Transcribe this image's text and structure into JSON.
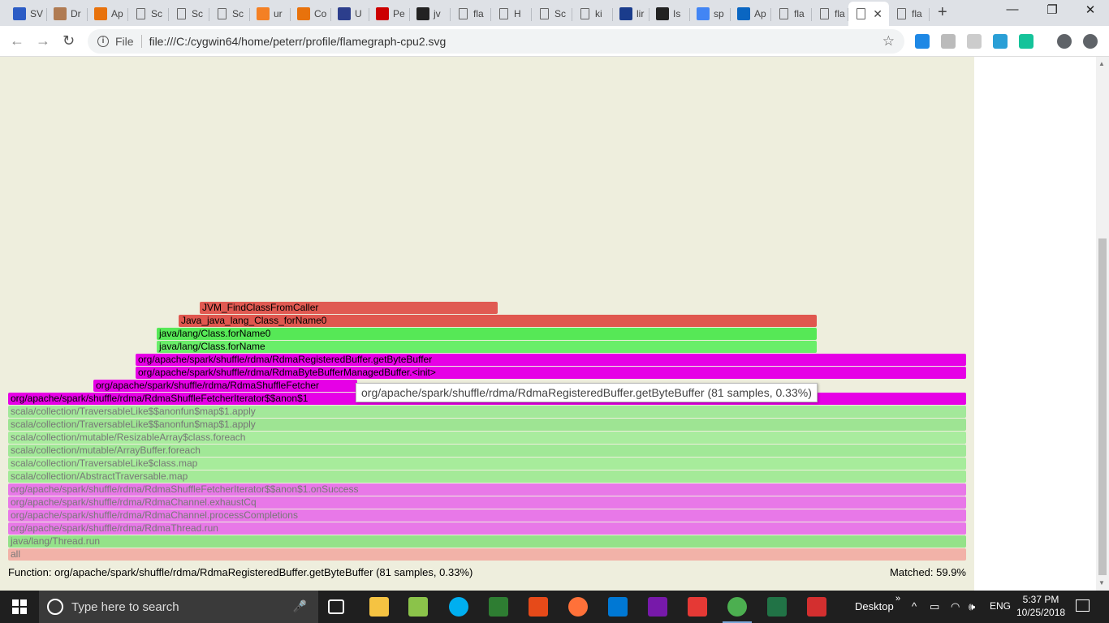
{
  "browser": {
    "tabs": [
      {
        "label": "SV",
        "icon": "atlassian-icon",
        "color": "#2c5cc5"
      },
      {
        "label": "Dr",
        "icon": "avatar-icon",
        "color": "#b07b52"
      },
      {
        "label": "Ap",
        "icon": "star-badge-icon",
        "color": "#e8720c"
      },
      {
        "label": "Sc",
        "icon": "page-icon",
        "color": ""
      },
      {
        "label": "Sc",
        "icon": "page-icon",
        "color": ""
      },
      {
        "label": "Sc",
        "icon": "page-icon",
        "color": ""
      },
      {
        "label": "ur",
        "icon": "stackoverflow-icon",
        "color": "#f48024"
      },
      {
        "label": "Co",
        "icon": "star-badge-icon",
        "color": "#e8720c"
      },
      {
        "label": "U",
        "icon": "mellanox-icon",
        "color": "#2c3e8c"
      },
      {
        "label": "Pe",
        "icon": "redhat-icon",
        "color": "#cc0000"
      },
      {
        "label": "jv",
        "icon": "github-icon",
        "color": "#222222"
      },
      {
        "label": "fla",
        "icon": "page-icon",
        "color": ""
      },
      {
        "label": "H",
        "icon": "page-icon",
        "color": ""
      },
      {
        "label": "Sc",
        "icon": "page-icon",
        "color": ""
      },
      {
        "label": "ki",
        "icon": "page-icon",
        "color": ""
      },
      {
        "label": "lir",
        "icon": "ul-icon",
        "color": "#1a3c8c"
      },
      {
        "label": "Is",
        "icon": "github-icon",
        "color": "#222222"
      },
      {
        "label": "sp",
        "icon": "google-icon",
        "color": "#4285f4"
      },
      {
        "label": "Ap",
        "icon": "linkedin-icon",
        "color": "#0a66c2"
      },
      {
        "label": "fla",
        "icon": "page-icon",
        "color": ""
      },
      {
        "label": "fla",
        "icon": "page-icon",
        "color": ""
      },
      {
        "label": "",
        "icon": "page-icon",
        "color": "",
        "active": true
      },
      {
        "label": "fla",
        "icon": "page-icon",
        "color": ""
      }
    ],
    "new_tab_label": "+",
    "minimize_label": "—",
    "maximize_label": "❐",
    "close_label": "✕",
    "back_label": "←",
    "forward_label": "→",
    "reload_label": "↻",
    "info_label": "i",
    "scheme": "File",
    "url": "file:///C:/cygwin64/home/peterr/profile/flamegraph-cpu2.svg",
    "star_label": "☆",
    "extensions": [
      {
        "name": "windows-ext-icon",
        "color": "#1e88e5"
      },
      {
        "name": "gear-ext-icon",
        "color": "#bbbbbb"
      },
      {
        "name": "circle-ext-icon",
        "color": "#cccccc"
      },
      {
        "name": "screen-ext-icon",
        "color": "#2a9fd6"
      },
      {
        "name": "grammarly-ext-icon",
        "color": "#15c39a"
      },
      {
        "name": "profile-icon",
        "color": "#5f6368"
      },
      {
        "name": "menu-icon",
        "color": "#5f6368"
      }
    ]
  },
  "flamegraph": {
    "background": "#eeeedd",
    "frames": [
      {
        "label": "JVM_FindClassFromCaller",
        "color": "#e05a52",
        "dim": false
      },
      {
        "label": "Java_java_lang_Class_forName0",
        "color": "#e0574f",
        "dim": false
      },
      {
        "label": "java/lang/Class.forName0",
        "color": "#56e856",
        "dim": false
      },
      {
        "label": "java/lang/Class.forName",
        "color": "#69ee69",
        "dim": false
      },
      {
        "label": "org/apache/spark/shuffle/rdma/RdmaRegisteredBuffer.getByteBuffer",
        "color": "#e600e6",
        "dim": false
      },
      {
        "label": "org/apache/spark/shuffle/rdma/RdmaByteBufferManagedBuffer.<init>",
        "color": "#e600e6",
        "dim": false
      },
      {
        "label": "org/apache/spark/shuffle/rdma/RdmaShuffleFetcher",
        "color": "#e600e6",
        "dim": false
      },
      {
        "label": "org/apache/spark/shuffle/rdma/RdmaShuffleFetcherIterator$$anon$1",
        "color": "#e600e6",
        "dim": false
      },
      {
        "label": "scala/collection/TraversableLike$$anonfun$map$1.apply",
        "color": "#a3e89a",
        "dim": true
      },
      {
        "label": "scala/collection/TraversableLike$$anonfun$map$1.apply",
        "color": "#9ee493",
        "dim": true
      },
      {
        "label": "scala/collection/mutable/ResizableArray$class.foreach",
        "color": "#a9ec9e",
        "dim": true
      },
      {
        "label": "scala/collection/mutable/ArrayBuffer.foreach",
        "color": "#a1e897",
        "dim": true
      },
      {
        "label": "scala/collection/TraversableLike$class.map",
        "color": "#a7ec9b",
        "dim": true
      },
      {
        "label": "scala/collection/AbstractTraversable.map",
        "color": "#a4ea98",
        "dim": true
      },
      {
        "label": "org/apache/spark/shuffle/rdma/RdmaShuffleFetcherIterator$$anon$1.onSuccess",
        "color": "#e878e8",
        "dim": true
      },
      {
        "label": "org/apache/spark/shuffle/rdma/RdmaChannel.exhaustCq",
        "color": "#e878e8",
        "dim": true
      },
      {
        "label": "org/apache/spark/shuffle/rdma/RdmaChannel.processCompletions",
        "color": "#e878e8",
        "dim": true
      },
      {
        "label": "org/apache/spark/shuffle/rdma/RdmaThread.run",
        "color": "#e878e8",
        "dim": true
      },
      {
        "label": "java/lang/Thread.run",
        "color": "#94e289",
        "dim": true
      },
      {
        "label": "all",
        "color": "#f2b2a8",
        "dim": true
      }
    ],
    "tooltip": "org/apache/spark/shuffle/rdma/RdmaRegisteredBuffer.getByteBuffer (81 samples, 0.33%)",
    "details": "Function: org/apache/spark/shuffle/rdma/RdmaRegisteredBuffer.getByteBuffer (81 samples, 0.33%)",
    "matched": "Matched: 59.9%"
  },
  "taskbar": {
    "search_placeholder": "Type here to search",
    "mic_label": "🎤",
    "apps": [
      {
        "name": "task-view-icon",
        "color": "#ffffff",
        "running": false
      },
      {
        "name": "file-explorer-icon",
        "color": "#f5c342",
        "running": false
      },
      {
        "name": "notepad-plus-icon",
        "color": "#8bc34a",
        "running": false
      },
      {
        "name": "skype-icon",
        "color": "#00aff0",
        "running": false
      },
      {
        "name": "terminal-icon",
        "color": "#2e7d32",
        "running": false
      },
      {
        "name": "intellij-icon",
        "color": "#e64a19",
        "running": false
      },
      {
        "name": "firefox-icon",
        "color": "#ff7139",
        "running": false
      },
      {
        "name": "outlook-icon",
        "color": "#0078d4",
        "running": false
      },
      {
        "name": "onenote-icon",
        "color": "#7719aa",
        "running": false
      },
      {
        "name": "rocket-app-icon",
        "color": "#e53935",
        "running": false
      },
      {
        "name": "chrome-icon",
        "color": "#4caf50",
        "running": true
      },
      {
        "name": "excel-icon",
        "color": "#217346",
        "running": false
      },
      {
        "name": "acrobat-icon",
        "color": "#d32f2f",
        "running": false
      }
    ],
    "desktop_label": "Desktop",
    "chevron_label": "»",
    "tray_caret": "^",
    "tray_battery": "▭",
    "tray_wifi": "◠",
    "tray_volume": "🕪",
    "lang": "ENG",
    "time": "5:37 PM",
    "date": "10/25/2018"
  }
}
